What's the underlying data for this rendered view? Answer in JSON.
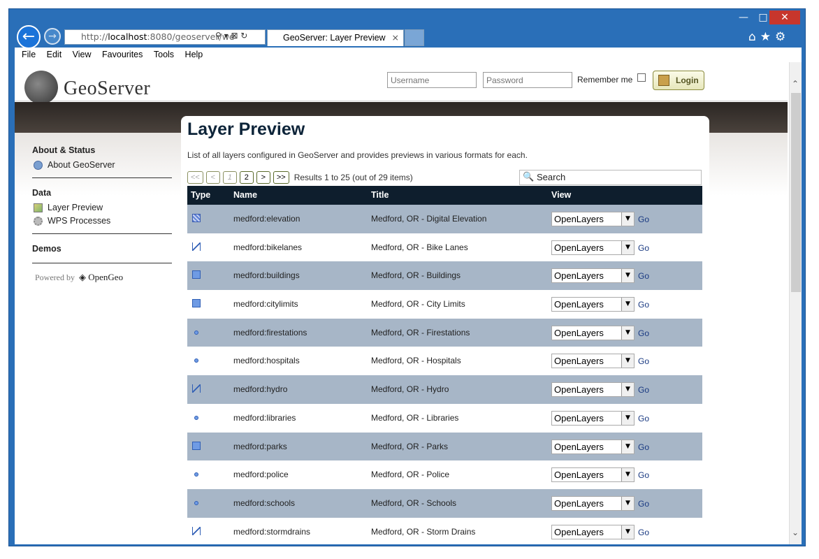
{
  "browser": {
    "url_prefix": "http://",
    "url_host": "localhost",
    "url_rest": ":8080/geoserver/we",
    "tab_title": "GeoServer: Layer Preview",
    "tab_close": "×",
    "win_min": "—",
    "win_max": "□",
    "win_close": "✕",
    "addr_icons": "⚲ ▾  ⊠ ↻",
    "tool_icons": "⌂★⚙",
    "icons": [
      "back-arrow-icon",
      "forward-arrow-icon",
      "search-icon",
      "compat-icon",
      "refresh-icon",
      "home-icon",
      "star-icon",
      "gear-icon"
    ]
  },
  "menu": [
    "File",
    "Edit",
    "View",
    "Favourites",
    "Tools",
    "Help"
  ],
  "header": {
    "logo": "GeoServer",
    "username_placeholder": "Username",
    "password_placeholder": "Password",
    "remember": "Remember me",
    "login": "Login"
  },
  "sidebar": {
    "sections": [
      {
        "title": "About & Status",
        "items": [
          "About GeoServer"
        ]
      },
      {
        "title": "Data",
        "items": [
          "Layer Preview",
          "WPS Processes"
        ]
      },
      {
        "title": "Demos",
        "items": []
      }
    ],
    "powered_by": "Powered by",
    "powered_brand": "OpenGeo"
  },
  "main": {
    "title": "Layer Preview",
    "description": "List of all layers configured in GeoServer and provides previews in various formats for each.",
    "pager": {
      "first": "<<",
      "prev": "<",
      "page1": "1",
      "page2": "2",
      "next": ">",
      "last": ">>",
      "results": "Results 1 to 25 (out of 29 items)"
    },
    "search": "Search",
    "columns": [
      "Type",
      "Name",
      "Title",
      "View"
    ],
    "rows": [
      {
        "type": "raster",
        "name": "medford:elevation",
        "title": "Medford, OR - Digital Elevation"
      },
      {
        "type": "line",
        "name": "medford:bikelanes",
        "title": "Medford, OR - Bike Lanes"
      },
      {
        "type": "polygon",
        "name": "medford:buildings",
        "title": "Medford, OR - Buildings"
      },
      {
        "type": "polygon",
        "name": "medford:citylimits",
        "title": "Medford, OR - City Limits"
      },
      {
        "type": "point",
        "name": "medford:firestations",
        "title": "Medford, OR - Firestations"
      },
      {
        "type": "point",
        "name": "medford:hospitals",
        "title": "Medford, OR - Hospitals"
      },
      {
        "type": "line",
        "name": "medford:hydro",
        "title": "Medford, OR - Hydro"
      },
      {
        "type": "point",
        "name": "medford:libraries",
        "title": "Medford, OR - Libraries"
      },
      {
        "type": "polygon",
        "name": "medford:parks",
        "title": "Medford, OR - Parks"
      },
      {
        "type": "point",
        "name": "medford:police",
        "title": "Medford, OR - Police"
      },
      {
        "type": "point",
        "name": "medford:schools",
        "title": "Medford, OR - Schools"
      },
      {
        "type": "line",
        "name": "medford:stormdrains",
        "title": "Medford, OR - Storm Drains"
      }
    ],
    "view_option": "OpenLayers",
    "go": "Go"
  },
  "colors": {
    "row_alt": "#a7b6c7",
    "header": "#0e1e2d",
    "title": "#0d2439",
    "link": "#1a3a82"
  }
}
